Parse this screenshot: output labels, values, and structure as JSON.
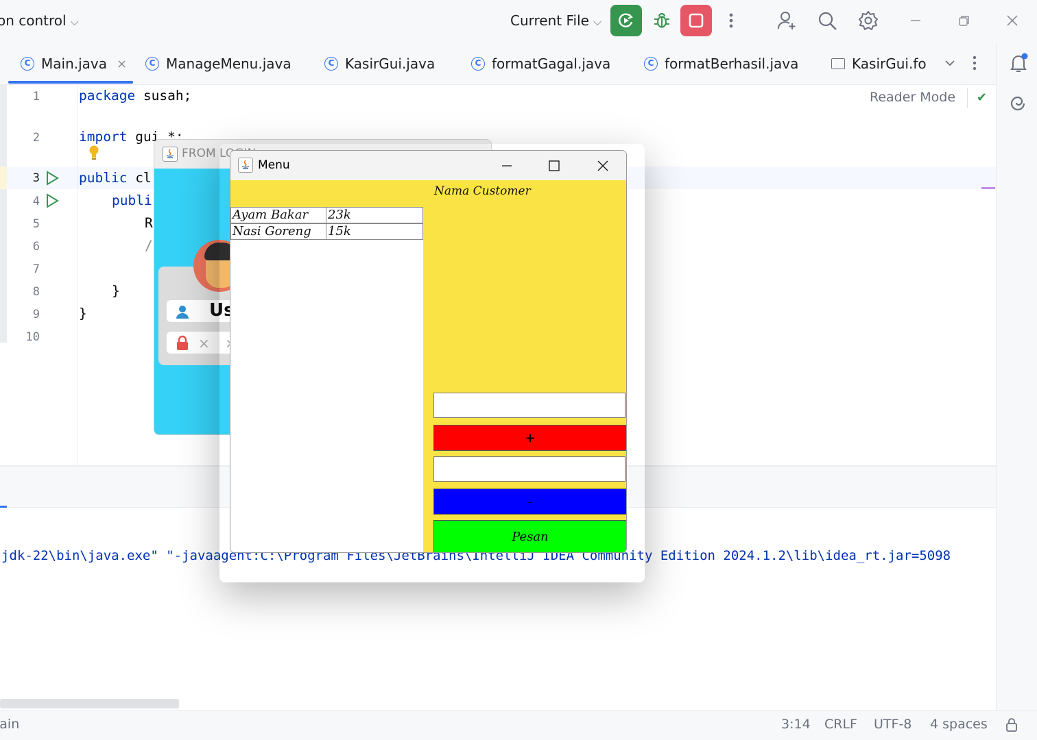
{
  "ide": {
    "vcs_widget": "on control",
    "run_config": "Current File",
    "tabs": [
      {
        "label": "Main.java",
        "active": true
      },
      {
        "label": "ManageMenu.java"
      },
      {
        "label": "KasirGui.java"
      },
      {
        "label": "formatGagal.java"
      },
      {
        "label": "formatBerhasil.java"
      },
      {
        "label": "KasirGui.for"
      }
    ],
    "tab_close": "×",
    "reader_mode": "Reader Mode",
    "line_numbers": [
      "1",
      "2",
      "3",
      "4",
      "5",
      "6",
      "7",
      "8",
      "9",
      "10"
    ],
    "code": {
      "l1_kw": "package",
      "l1_rest": " susah;",
      "l2_kw": "import",
      "l2_rest": " gui.*;",
      "l3_kw": "public",
      "l3_rest": " cl",
      "l4_kw": "publi",
      "l5": "R",
      "l6": "/",
      "l8": "}",
      "l9": "}"
    },
    "console_line": "jdk-22\\bin\\java.exe\" \"-javaagent:C:\\Program Files\\JetBrains\\IntelliJ IDEA Community Edition 2024.1.2\\lib\\idea_rt.jar=5098",
    "status": {
      "left": "lain",
      "position": "3:14",
      "line_sep": "CRLF",
      "encoding": "UTF-8",
      "indent": "4 spaces"
    },
    "colors": {
      "run_green": "#369650",
      "stop_red": "#e55765",
      "accent": "#3574f0"
    }
  },
  "login_window": {
    "title": "FROM LOGIN",
    "user_label": "Us",
    "password_mask": "× ×"
  },
  "menu_window": {
    "title": "Menu",
    "controls": {
      "minimize": "—",
      "maximize": "☐",
      "close": "✕"
    },
    "customer_label": "Nama Customer",
    "items": [
      {
        "name": "Ayam Bakar",
        "price": "23k"
      },
      {
        "name": "Nasi Goreng",
        "price": "15k"
      }
    ],
    "plus_button": "+",
    "minus_button": "-",
    "order_button": "Pesan",
    "colors": {
      "background": "#fae445",
      "plus": "#ff0000",
      "minus": "#0000ff",
      "order": "#00ff00"
    }
  }
}
